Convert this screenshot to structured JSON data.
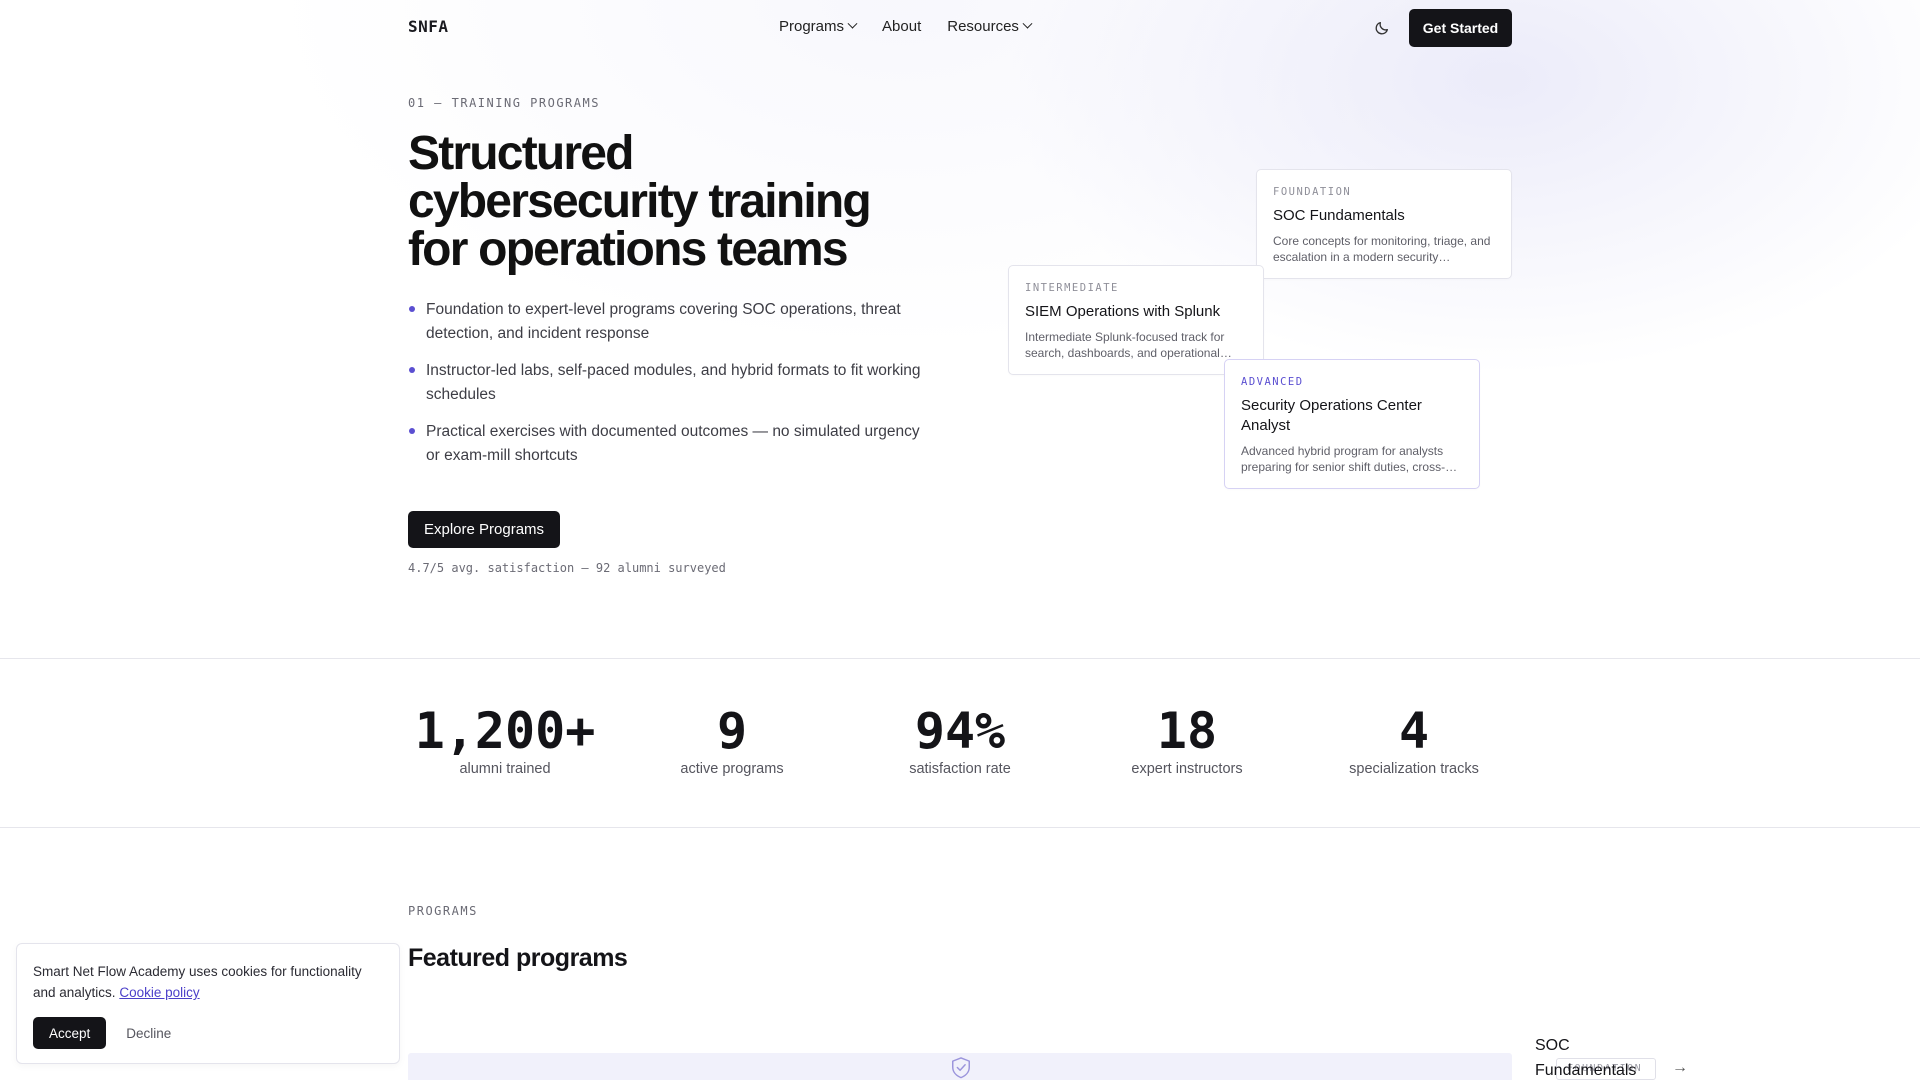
{
  "nav": {
    "logo": "SNFA",
    "menu": [
      {
        "label": "Programs"
      },
      {
        "label": "About"
      },
      {
        "label": "Resources"
      }
    ],
    "cta": "Get Started"
  },
  "hero": {
    "eyebrow": "01 — TRAINING PROGRAMS",
    "title": "Structured cybersecurity training for operations teams",
    "bullets": [
      "Foundation to expert-level programs covering SOC operations, threat detection, and incident response",
      "Instructor-led labs, self-paced modules, and hybrid formats to fit working schedules",
      "Practical exercises with documented outcomes — no simulated urgency or exam-mill shortcuts"
    ],
    "cta": "Explore Programs",
    "rating": "4.7/5 avg. satisfaction — 92 alumni surveyed"
  },
  "cards": [
    {
      "level": "FOUNDATION",
      "title": "SOC Fundamentals",
      "desc": "Core concepts for monitoring, triage, and escalation in a modern security operations center."
    },
    {
      "level": "INTERMEDIATE",
      "title": "SIEM Operations with Splunk",
      "desc": "Intermediate Splunk-focused track for search, dashboards, and operational alerting workflows."
    },
    {
      "level": "ADVANCED",
      "title": "Security Operations Center Analyst",
      "desc": "Advanced hybrid program for analysts preparing for senior shift duties, cross-team escalation and reporting."
    }
  ],
  "stats": [
    {
      "value": "1,200+",
      "label": "alumni trained"
    },
    {
      "value": "9",
      "label": "active programs"
    },
    {
      "value": "94%",
      "label": "satisfaction rate"
    },
    {
      "value": "18",
      "label": "expert instructors"
    },
    {
      "value": "4",
      "label": "specialization tracks"
    }
  ],
  "programs": {
    "eyebrow": "PROGRAMS",
    "title": "Featured programs",
    "side_title": "SOC Fundamentals",
    "side_badge": "FOUNDATION"
  },
  "cookie": {
    "text": "Smart Net Flow Academy uses cookies for functionality and analytics.",
    "link": "Cookie policy",
    "accept": "Accept",
    "decline": "Decline"
  },
  "colors": {
    "accent": "#5b4fd1",
    "dark": "#141418"
  }
}
